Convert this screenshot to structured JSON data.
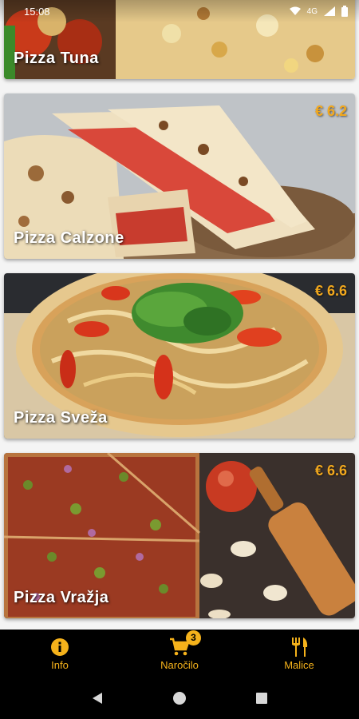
{
  "status_bar": {
    "time": "15:08",
    "network": "4G"
  },
  "pizzas": [
    {
      "name": "Pizza Tuna",
      "price": ""
    },
    {
      "name": "Pizza Calzone",
      "price": "€ 6.2"
    },
    {
      "name": "Pizza Sveža",
      "price": "€ 6.6"
    },
    {
      "name": "Pizza Vražja",
      "price": "€ 6.6"
    }
  ],
  "bottom_nav": {
    "info_label": "Info",
    "order_label": "Naročilo",
    "order_badge": "3",
    "menu_label": "Malice"
  },
  "colors": {
    "accent": "#f5b21b",
    "price": "#f2a81d",
    "nav_bg": "#000000"
  }
}
